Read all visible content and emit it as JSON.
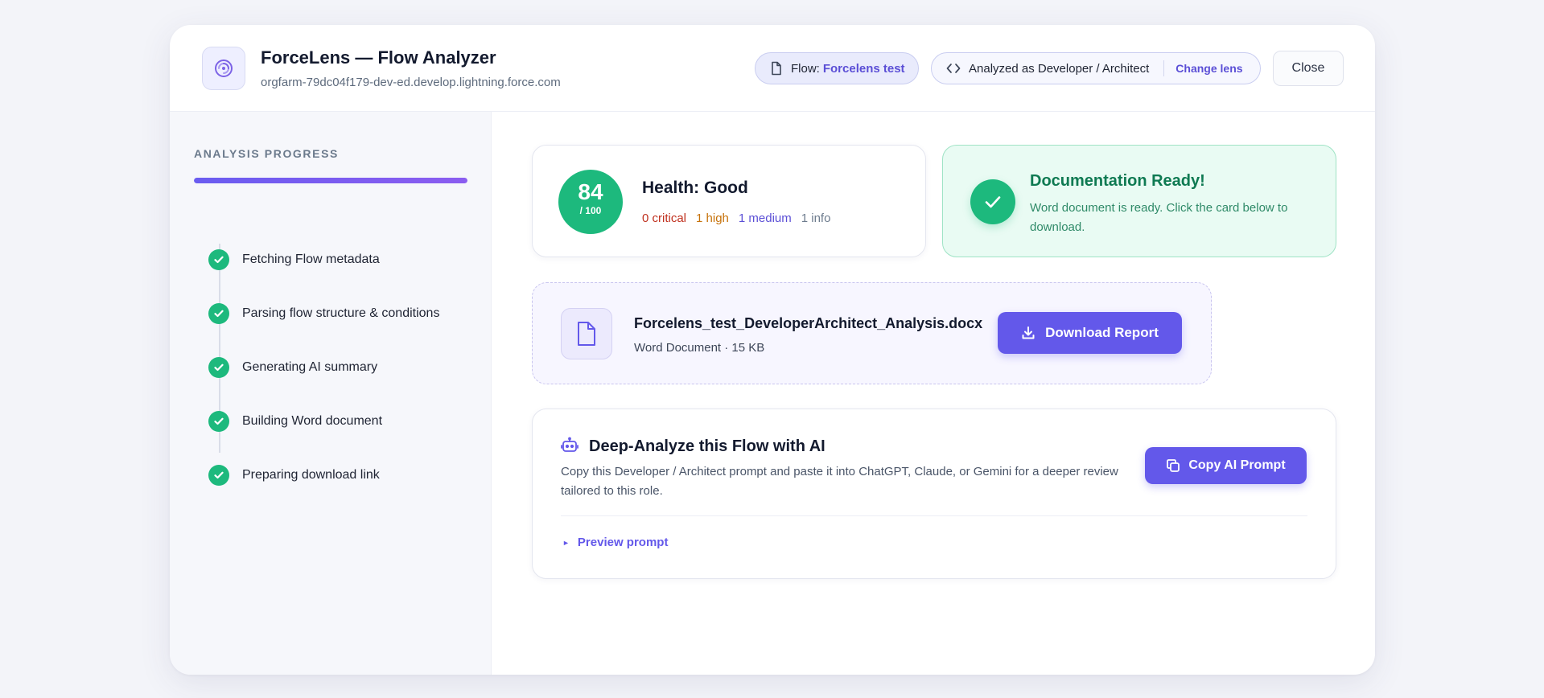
{
  "header": {
    "title": "ForceLens — Flow Analyzer",
    "subtitle": "orgfarm-79dc04f179-dev-ed.develop.lightning.force.com",
    "flow_chip": {
      "prefix": "Flow:",
      "value": "Forcelens test"
    },
    "lens_chip": {
      "label": "Analyzed as Developer / Architect",
      "action": "Change lens"
    },
    "close_label": "Close"
  },
  "sidebar": {
    "title": "ANALYSIS PROGRESS",
    "progress_percent": 100,
    "steps": [
      {
        "label": "Fetching Flow metadata",
        "status": "done"
      },
      {
        "label": "Parsing flow structure & conditions",
        "status": "done"
      },
      {
        "label": "Generating AI summary",
        "status": "done"
      },
      {
        "label": "Building Word document",
        "status": "done"
      },
      {
        "label": "Preparing download link",
        "status": "done"
      }
    ]
  },
  "health": {
    "score": "84",
    "score_max": "/ 100",
    "title": "Health: Good",
    "critical": "0 critical",
    "high": "1 high",
    "medium": "1 medium",
    "info": "1 info"
  },
  "doc_ready": {
    "title": "Documentation Ready!",
    "text": "Word document is ready. Click the card below to download."
  },
  "file": {
    "name": "Forcelens_test_DeveloperArchitect_Analysis.docx",
    "meta": "Word Document · 15 KB",
    "download_label": "Download Report"
  },
  "ai": {
    "title": "Deep-Analyze this Flow with AI",
    "text": "Copy this Developer / Architect prompt and paste it into ChatGPT, Claude, or Gemini for a deeper review tailored to this role.",
    "copy_label": "Copy AI Prompt",
    "preview_label": "Preview prompt"
  },
  "colors": {
    "accent": "#6358ea",
    "success": "#1db97d",
    "critical": "#c0311f",
    "high": "#c6720a"
  },
  "icons": {
    "logo": "swirl-logo-icon",
    "flow": "document-icon",
    "lens": "code-icon",
    "step": "check-icon",
    "ready": "check-icon",
    "file": "document-icon",
    "download": "download-icon",
    "ai": "robot-icon",
    "copy": "copy-icon",
    "preview": "triangle-right-icon"
  }
}
